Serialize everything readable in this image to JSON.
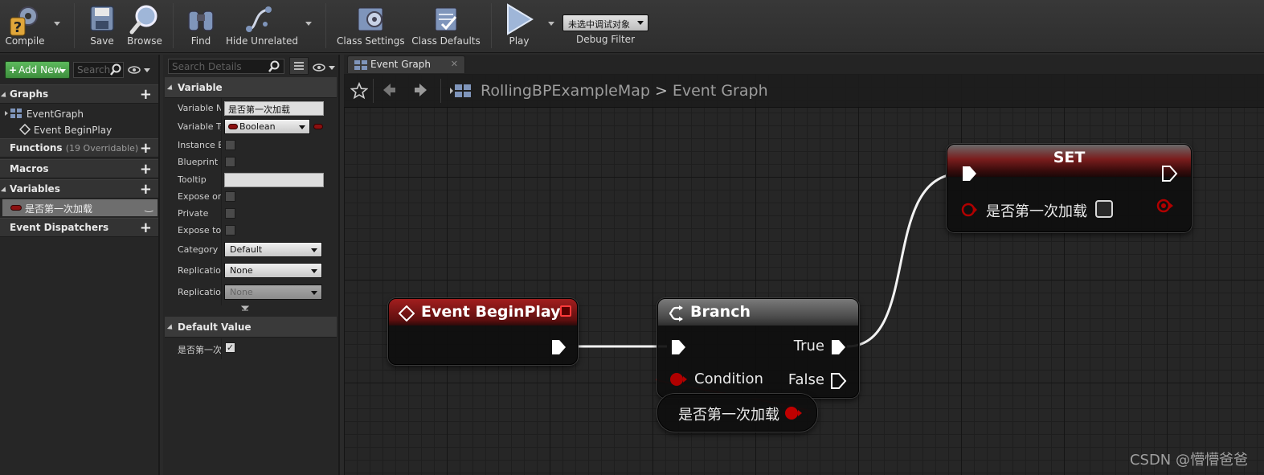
{
  "toolbar": {
    "compile": "Compile",
    "save": "Save",
    "browse": "Browse",
    "find": "Find",
    "hide_unrelated": "Hide Unrelated",
    "class_settings": "Class Settings",
    "class_defaults": "Class Defaults",
    "play": "Play",
    "debug_select_value": "未选中调试对象",
    "debug_filter": "Debug Filter"
  },
  "my_blueprint": {
    "add_new": "Add New",
    "search_placeholder": "Search",
    "graphs": "Graphs",
    "event_graph": "EventGraph",
    "event_begin_play": "Event BeginPlay",
    "functions": "Functions",
    "functions_overridable": "(19 Overridable)",
    "macros": "Macros",
    "variables": "Variables",
    "variable_item": "是否第一次加载",
    "event_dispatchers": "Event Dispatchers"
  },
  "details": {
    "search_placeholder": "Search Details",
    "variable_section": "Variable",
    "props": {
      "variable_name_label": "Variable Name",
      "variable_name_value": "是否第一次加载",
      "variable_type_label": "Variable Type",
      "variable_type_value": "Boolean",
      "instance_editable_label": "Instance Editable",
      "blueprint_read_only_label": "Blueprint Read Only",
      "tooltip_label": "Tooltip",
      "expose_on_spawn_label": "Expose on Spawn",
      "private_label": "Private",
      "expose_to_cinematics_label": "Expose to Cinematics",
      "category_label": "Category",
      "category_value": "Default",
      "replication_label": "Replication",
      "replication_value": "None",
      "replication_condition_label": "Replication Condition",
      "replication_condition_value": "None"
    },
    "default_value_section": "Default Value",
    "default_var_label": "是否第一次加载",
    "default_checked": true
  },
  "graph": {
    "tab_label": "Event Graph",
    "breadcrumb_map": "RollingBPExampleMap",
    "breadcrumb_sep": ">",
    "breadcrumb_graph": "Event Graph",
    "node_event": "Event BeginPlay",
    "node_branch": "Branch",
    "pin_true": "True",
    "pin_condition": "Condition",
    "pin_false": "False",
    "node_get_var": "是否第一次加载",
    "node_set": "SET",
    "set_var_label": "是否第一次加载"
  },
  "watermark": "CSDN @懵懵爸爸",
  "colors": {
    "event_header": "#8c1a1a",
    "bool_pin": "#a00000",
    "exec_pin": "#ffffff",
    "add_new_green": "#4ca64c"
  }
}
